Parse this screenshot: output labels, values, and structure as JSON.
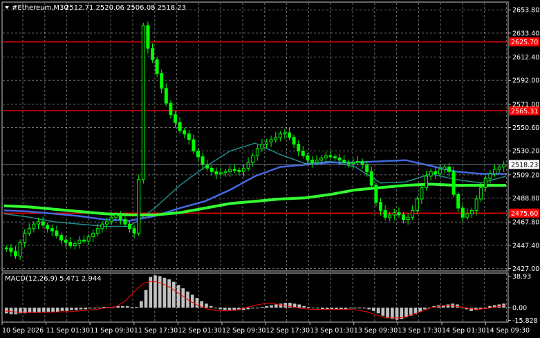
{
  "header": {
    "symbol": "#Ethereum,M30",
    "ohlc": "2512.71 2520.06 2506.08 2518.23"
  },
  "macd_header": "MACD(12,26,9) 5.471 2.944",
  "colors": {
    "background": "#000000",
    "grid": "#c8c8c8",
    "candle": "#00ff00",
    "ma_slow": "#32ff32",
    "ma_mid": "#4169e1",
    "ma_fast": "#1f8c8c",
    "level": "#ff0000",
    "macd_hist": "#c0c0c0",
    "macd_signal": "#ff0000"
  },
  "chart_data": [
    {
      "type": "line",
      "name": "price",
      "y_ticks": [
        "2653.80",
        "2633.40",
        "2612.40",
        "2592.00",
        "2571.00",
        "2550.60",
        "2530.20",
        "2509.20",
        "2488.80",
        "2467.80",
        "2447.40",
        "2427.00"
      ],
      "ylim": [
        2425.5,
        2660
      ],
      "x_ticks": [
        "10 Sep 2026",
        "11 Sep 01:30",
        "11 Sep 09:30",
        "11 Sep 17:30",
        "12 Sep 01:30",
        "12 Sep 09:30",
        "12 Sep 17:30",
        "13 Sep 01:30",
        "13 Sep 09:30",
        "13 Sep 17:30",
        "14 Sep 01:30",
        "14 Sep 09:30"
      ],
      "current_price": "2518.23",
      "levels": [
        "2625.70",
        "2565.31",
        "2475.60"
      ],
      "price": [
        2445,
        2442,
        2438,
        2450,
        2458,
        2462,
        2466,
        2468,
        2465,
        2462,
        2460,
        2456,
        2452,
        2450,
        2447,
        2449,
        2452,
        2451,
        2455,
        2458,
        2462,
        2466,
        2468,
        2472,
        2474,
        2470,
        2466,
        2462,
        2458,
        2505,
        2640,
        2620,
        2610,
        2598,
        2585,
        2572,
        2562,
        2555,
        2548,
        2545,
        2540,
        2530,
        2525,
        2518,
        2515,
        2512,
        2510,
        2511,
        2512,
        2514,
        2513,
        2512,
        2515,
        2520,
        2526,
        2532,
        2536,
        2538,
        2540,
        2542,
        2545,
        2546,
        2542,
        2536,
        2530,
        2526,
        2522,
        2520,
        2522,
        2524,
        2526,
        2525,
        2524,
        2522,
        2520,
        2519,
        2520,
        2521,
        2518,
        2512,
        2500,
        2485,
        2478,
        2472,
        2474,
        2476,
        2474,
        2470,
        2472,
        2478,
        2488,
        2498,
        2508,
        2512,
        2510,
        2514,
        2516,
        2512,
        2492,
        2480,
        2472,
        2475,
        2478,
        2488,
        2498,
        2506,
        2510,
        2514,
        2516,
        2518
      ],
      "ma_slow": [
        2482,
        2481,
        2479,
        2477,
        2475,
        2474,
        2474,
        2476,
        2480,
        2484,
        2486,
        2488,
        2489,
        2492,
        2496,
        2498,
        2500,
        2501,
        2500,
        2500,
        2500
      ],
      "ma_mid": [
        2478,
        2477,
        2475,
        2473,
        2470,
        2469,
        2473,
        2480,
        2486,
        2496,
        2508,
        2516,
        2518,
        2520,
        2520,
        2521,
        2522,
        2517,
        2512,
        2510,
        2510
      ],
      "ma_fast": [
        2475,
        2472,
        2468,
        2466,
        2464,
        2464,
        2480,
        2500,
        2516,
        2530,
        2537,
        2527,
        2519,
        2521,
        2516,
        2502,
        2503,
        2510,
        2505,
        2502,
        2508
      ]
    },
    {
      "type": "bar",
      "name": "MACD",
      "y_ticks": [
        "38.93",
        "0.00",
        "-15.828"
      ],
      "ylim": [
        -17,
        42
      ],
      "histogram": [
        -7,
        -8,
        -8,
        -7,
        -7,
        -6,
        -6,
        -6,
        -5,
        -5,
        -5,
        -5,
        -4,
        -4,
        -3,
        -3,
        -2,
        -2,
        -1,
        -1,
        0,
        1,
        1,
        1,
        2,
        2,
        2,
        1,
        1,
        8,
        22,
        38,
        40,
        39,
        37,
        35,
        32,
        28,
        24,
        20,
        16,
        12,
        8,
        5,
        2,
        0,
        -2,
        -3,
        -3,
        -3,
        -3,
        -3,
        -2,
        -1,
        0,
        1,
        2,
        3,
        4,
        5,
        6,
        6,
        5,
        4,
        2,
        1,
        0,
        -1,
        -2,
        -2,
        -2,
        -2,
        -2,
        -2,
        -1,
        -1,
        -1,
        -1,
        -2,
        -4,
        -7,
        -10,
        -13,
        -14,
        -15,
        -14,
        -12,
        -10,
        -8,
        -5,
        -2,
        0,
        2,
        3,
        3,
        4,
        5,
        4,
        1,
        -2,
        -4,
        -3,
        -2,
        0,
        2,
        3,
        4,
        5
      ],
      "signal": [
        -4,
        -5,
        -6,
        -6,
        -6,
        -6,
        -5,
        -5,
        -4,
        -3,
        -2,
        0,
        1,
        8,
        20,
        30,
        33,
        30,
        24,
        16,
        8,
        2,
        -2,
        -4,
        -4,
        -3,
        0,
        3,
        5,
        5,
        3,
        1,
        -1,
        -2,
        -2,
        -2,
        -2,
        -2,
        -3,
        -5,
        -9,
        -12,
        -13,
        -12,
        -8,
        -4,
        0,
        2,
        3,
        1,
        -1,
        -2,
        -1,
        1,
        3
      ]
    }
  ]
}
